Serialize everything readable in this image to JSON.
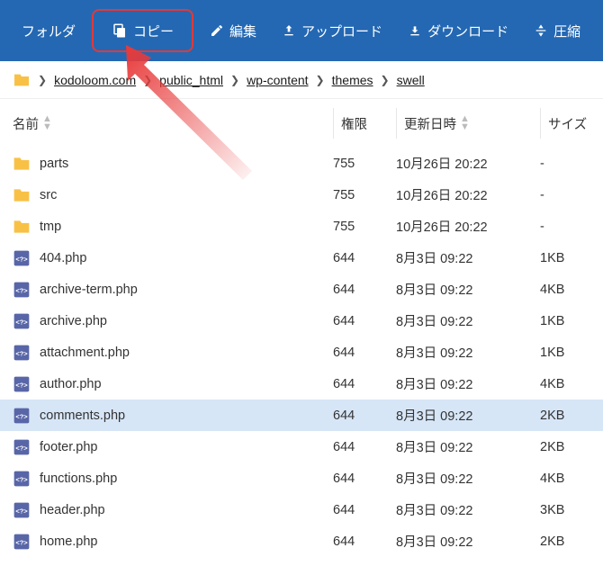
{
  "toolbar": {
    "folder_label": "フォルダ",
    "copy_label": "コピー",
    "edit_label": "編集",
    "upload_label": "アップロード",
    "download_label": "ダウンロード",
    "compress_label": "圧縮"
  },
  "breadcrumb": {
    "items": [
      "kodoloom.com",
      "public_html",
      "wp-content",
      "themes",
      "swell"
    ]
  },
  "columns": {
    "name": "名前",
    "perm": "権限",
    "date": "更新日時",
    "size": "サイズ"
  },
  "rows": [
    {
      "type": "folder",
      "name": "parts",
      "perm": "755",
      "date": "10月26日 20:22",
      "size": "-",
      "selected": false
    },
    {
      "type": "folder",
      "name": "src",
      "perm": "755",
      "date": "10月26日 20:22",
      "size": "-",
      "selected": false
    },
    {
      "type": "folder",
      "name": "tmp",
      "perm": "755",
      "date": "10月26日 20:22",
      "size": "-",
      "selected": false
    },
    {
      "type": "php",
      "name": "404.php",
      "perm": "644",
      "date": "8月3日 09:22",
      "size": "1KB",
      "selected": false
    },
    {
      "type": "php",
      "name": "archive-term.php",
      "perm": "644",
      "date": "8月3日 09:22",
      "size": "4KB",
      "selected": false
    },
    {
      "type": "php",
      "name": "archive.php",
      "perm": "644",
      "date": "8月3日 09:22",
      "size": "1KB",
      "selected": false
    },
    {
      "type": "php",
      "name": "attachment.php",
      "perm": "644",
      "date": "8月3日 09:22",
      "size": "1KB",
      "selected": false
    },
    {
      "type": "php",
      "name": "author.php",
      "perm": "644",
      "date": "8月3日 09:22",
      "size": "4KB",
      "selected": false
    },
    {
      "type": "php",
      "name": "comments.php",
      "perm": "644",
      "date": "8月3日 09:22",
      "size": "2KB",
      "selected": true
    },
    {
      "type": "php",
      "name": "footer.php",
      "perm": "644",
      "date": "8月3日 09:22",
      "size": "2KB",
      "selected": false
    },
    {
      "type": "php",
      "name": "functions.php",
      "perm": "644",
      "date": "8月3日 09:22",
      "size": "4KB",
      "selected": false
    },
    {
      "type": "php",
      "name": "header.php",
      "perm": "644",
      "date": "8月3日 09:22",
      "size": "3KB",
      "selected": false
    },
    {
      "type": "php",
      "name": "home.php",
      "perm": "644",
      "date": "8月3日 09:22",
      "size": "2KB",
      "selected": false
    }
  ]
}
